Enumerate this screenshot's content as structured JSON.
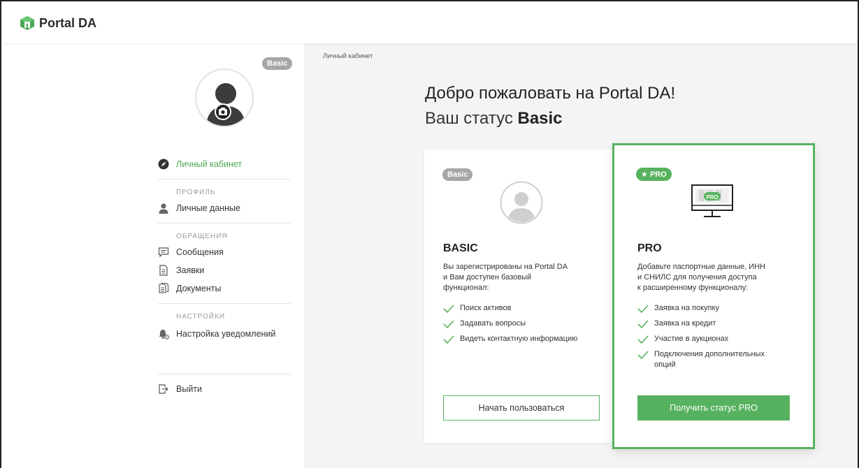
{
  "app": {
    "name": "Portal DA"
  },
  "sidebar": {
    "badge": "Basic",
    "nav": {
      "cabinet": "Личный кабинет",
      "profile_head": "ПРОФИЛЬ",
      "personal": "Личные данные",
      "requests_head": "ОБРАЩЕНИЯ",
      "messages": "Сообщения",
      "applications": "Заявки",
      "documents": "Документы",
      "settings_head": "НАСТРОЙКИ",
      "notifications": "Настройка уведомлений",
      "logout": "Выйти"
    }
  },
  "main": {
    "breadcrumb": "Личный кабинет",
    "welcome": "Добро пожаловать на Portal DA!",
    "status_prefix": "Ваш статус",
    "status_value": "Basic"
  },
  "basic_card": {
    "tag": "Basic",
    "title": "BASIC",
    "desc": "Вы зарегистрированы на Portal DA\nи Вам доступен базовый\nфункционал:",
    "features": [
      "Поиск активов",
      "Задавать вопросы",
      "Видеть контактную информацию"
    ],
    "button": "Начать пользоваться"
  },
  "pro_card": {
    "tag": "PRO",
    "screen_label": "PRO",
    "title": "PRO",
    "desc": "Добавьте паспортные данные, ИНН\nи СНИЛС для получения доступа\nк расширенному функционалу:",
    "features": [
      "Заявка на покупку",
      "Заявка на кредит",
      "Участие в аукционах",
      "Подключения дополнительных опций"
    ],
    "button": "Получить статус PRO"
  },
  "colors": {
    "accent": "#57b25f",
    "badge_gray": "#a6a6a6",
    "background": "#f4f4f4"
  },
  "icons": {
    "logo": "portal-da-logo-icon",
    "cabinet": "compass-icon",
    "personal": "user-icon",
    "messages": "message-icon",
    "applications": "document-icon",
    "documents": "documents-icon",
    "notifications": "bell-gear-icon",
    "logout": "logout-icon",
    "check": "check-icon",
    "star": "star-icon",
    "camera": "camera-icon"
  }
}
